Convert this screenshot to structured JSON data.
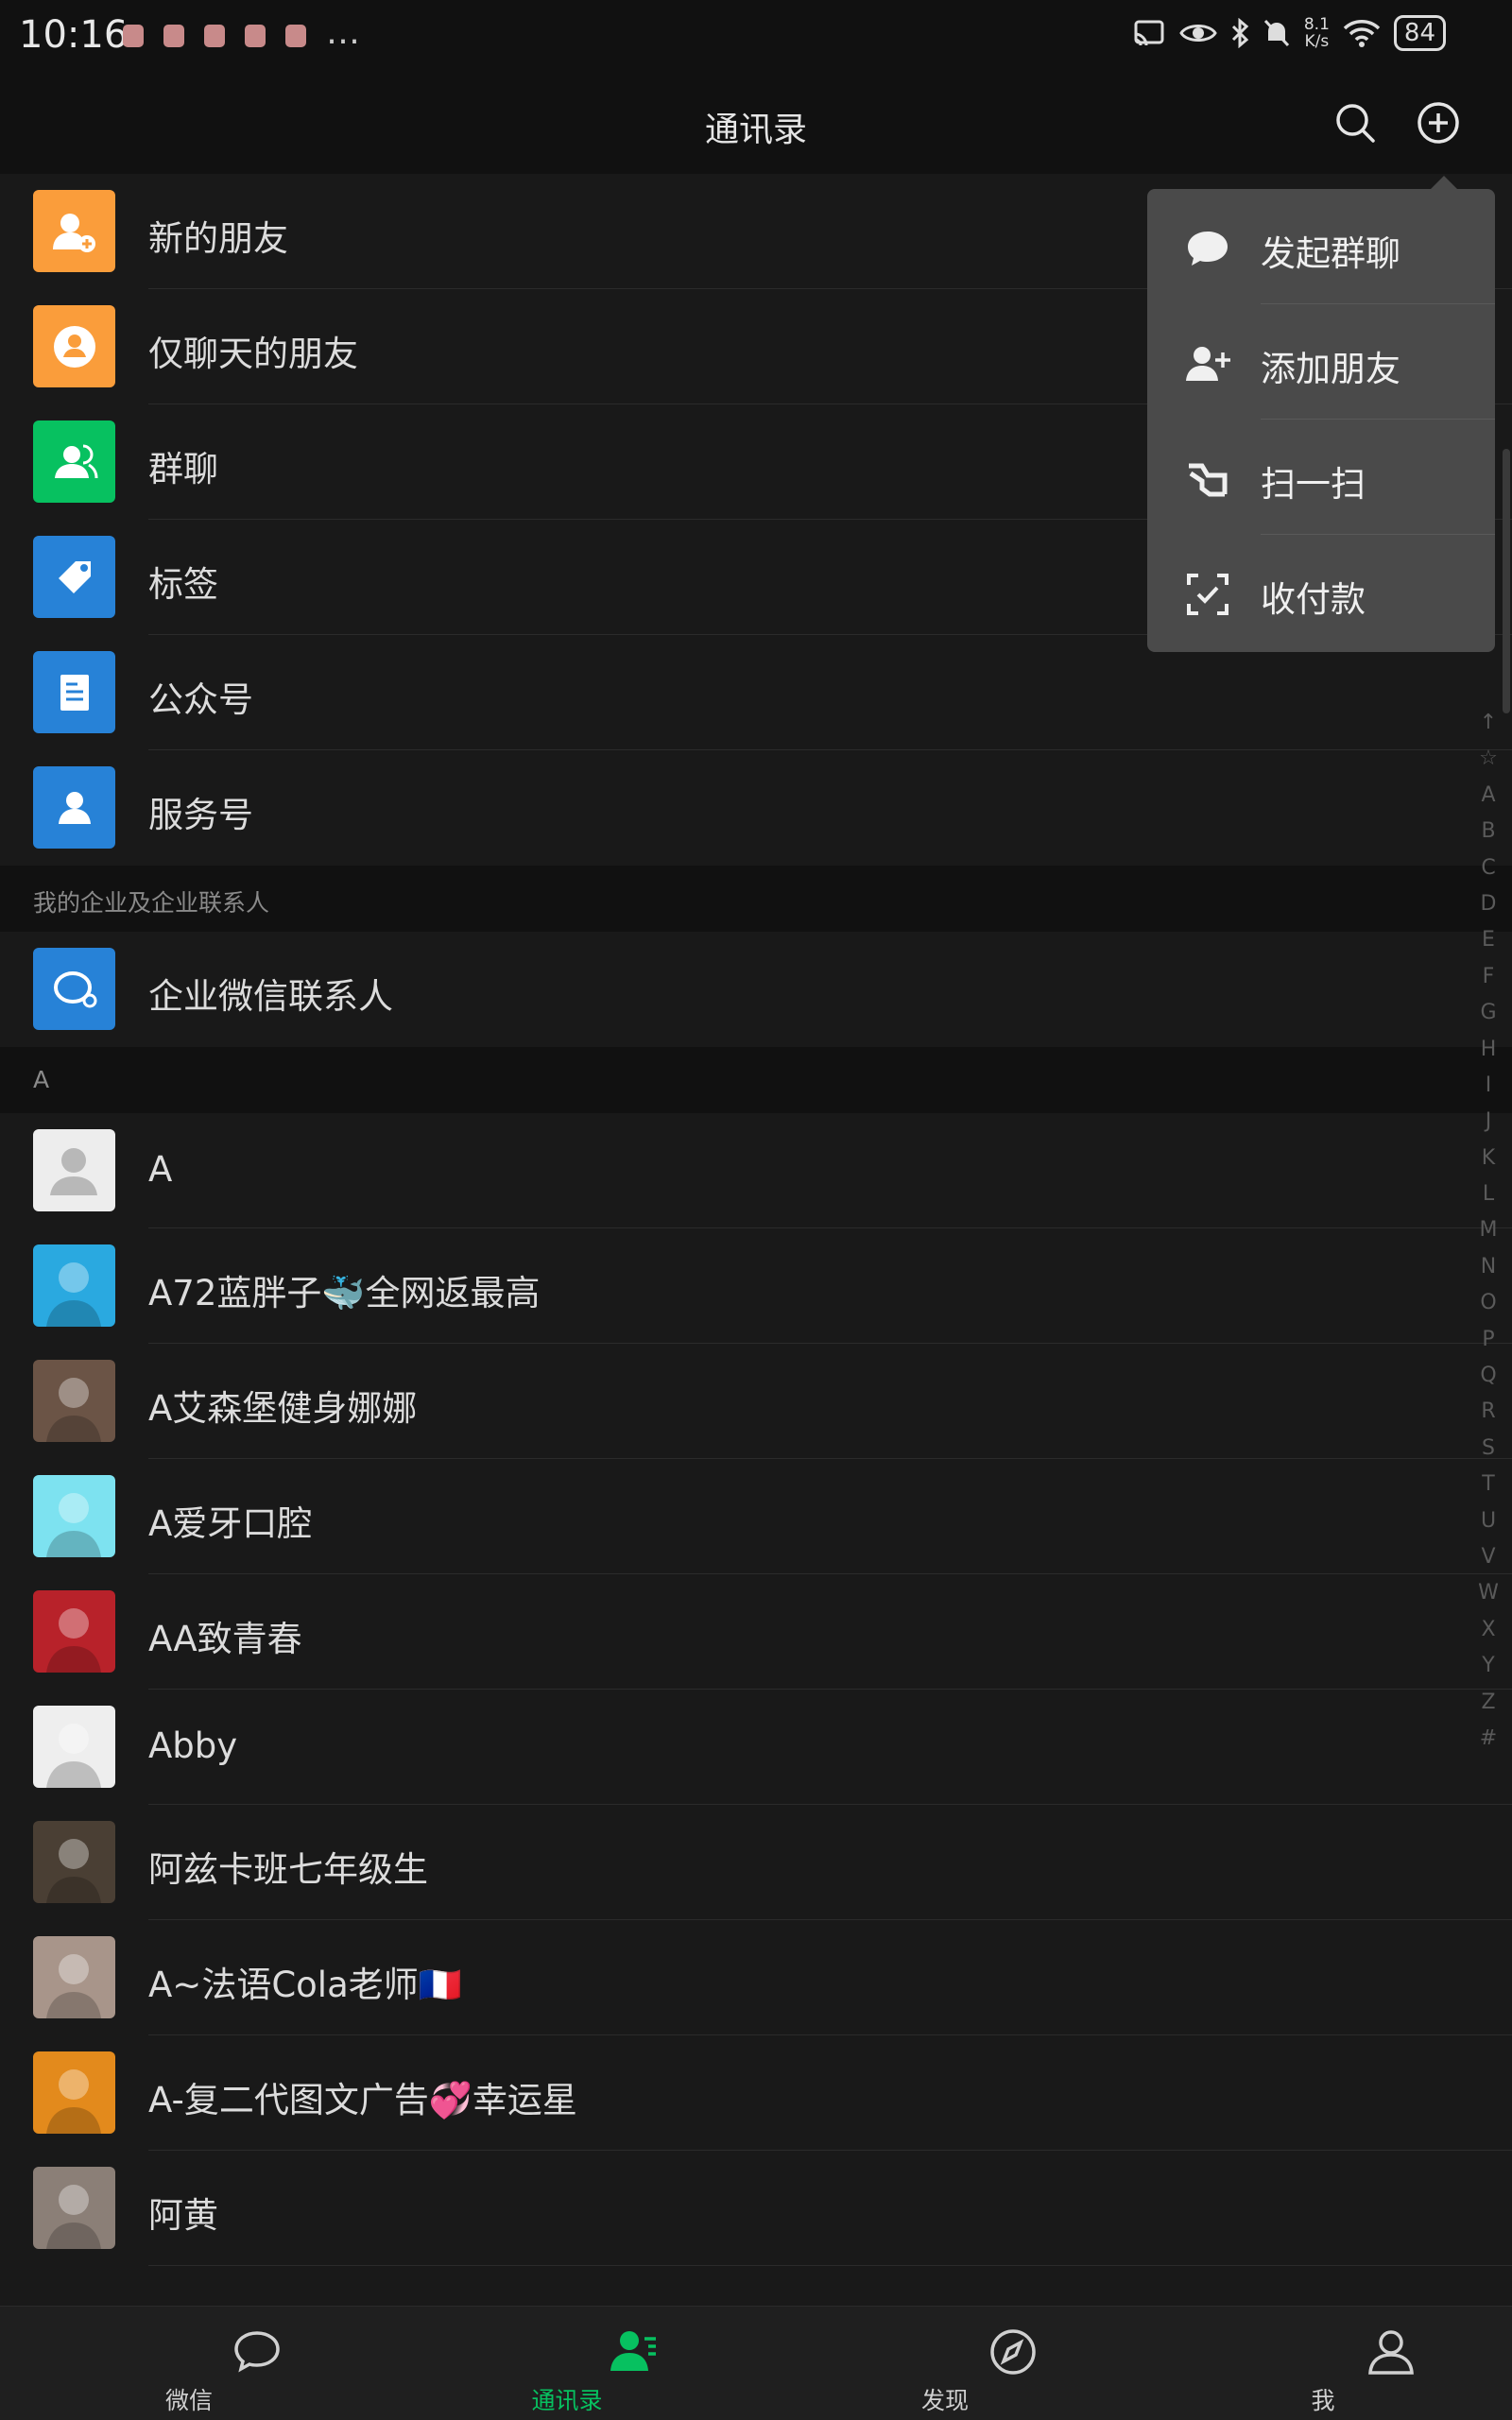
{
  "status_bar": {
    "time": "10:16",
    "more": "…",
    "speed_top": "8.1",
    "speed_bottom": "K/s",
    "battery": "84"
  },
  "header": {
    "title": "通讯录"
  },
  "top_items": [
    {
      "label": "新的朋友",
      "color": "#fa9d3b",
      "icon": "add-friend-icon"
    },
    {
      "label": "仅聊天的朋友",
      "color": "#fa9d3b",
      "icon": "chat-only-icon"
    },
    {
      "label": "群聊",
      "color": "#07c160",
      "icon": "group-icon"
    },
    {
      "label": "标签",
      "color": "#2782d7",
      "icon": "tag-icon"
    },
    {
      "label": "公众号",
      "color": "#2782d7",
      "icon": "official-account-icon"
    },
    {
      "label": "服务号",
      "color": "#2782d7",
      "icon": "service-account-icon"
    }
  ],
  "enterprise_section": {
    "header": "我的企业及企业联系人",
    "item": "企业微信联系人"
  },
  "letter_section": "A",
  "contacts": [
    {
      "name": "A",
      "color": "#d9d9d9"
    },
    {
      "name": "A72蓝胖子🐳全网返最高",
      "color": "#2aa9e0"
    },
    {
      "name": "A艾森堡健身娜娜",
      "color": "#6b5446"
    },
    {
      "name": "A爱牙口腔",
      "color": "#7de2f0"
    },
    {
      "name": "AA致青春",
      "color": "#b8222a"
    },
    {
      "name": "Abby",
      "color": "#eeeeee"
    },
    {
      "name": "阿兹卡班七年级生",
      "color": "#4a3f34"
    },
    {
      "name": "A~法语Cola老师🇫🇷",
      "color": "#a8958a"
    },
    {
      "name": "A-复二代图文广告💞幸运星",
      "color": "#e38a1c"
    },
    {
      "name": "阿黄",
      "color": "#8b7f77"
    }
  ],
  "index_letters": [
    "↑",
    "☆",
    "A",
    "B",
    "C",
    "D",
    "E",
    "F",
    "G",
    "H",
    "I",
    "J",
    "K",
    "L",
    "M",
    "N",
    "O",
    "P",
    "Q",
    "R",
    "S",
    "T",
    "U",
    "V",
    "W",
    "X",
    "Y",
    "Z",
    "#"
  ],
  "popup_menu": [
    {
      "label": "发起群聊",
      "icon": "chat-bubble-icon"
    },
    {
      "label": "添加朋友",
      "icon": "add-friend-icon"
    },
    {
      "label": "扫一扫",
      "icon": "scan-icon"
    },
    {
      "label": "收付款",
      "icon": "payment-icon"
    }
  ],
  "tabs": [
    {
      "label": "微信",
      "icon": "chat-icon",
      "active": false
    },
    {
      "label": "通讯录",
      "icon": "contacts-icon",
      "active": true
    },
    {
      "label": "发现",
      "icon": "compass-icon",
      "active": false
    },
    {
      "label": "我",
      "icon": "person-icon",
      "active": false
    }
  ],
  "colors": {
    "accent": "#07c160",
    "background": "#191919",
    "menu_bg": "#4a4a4a"
  }
}
